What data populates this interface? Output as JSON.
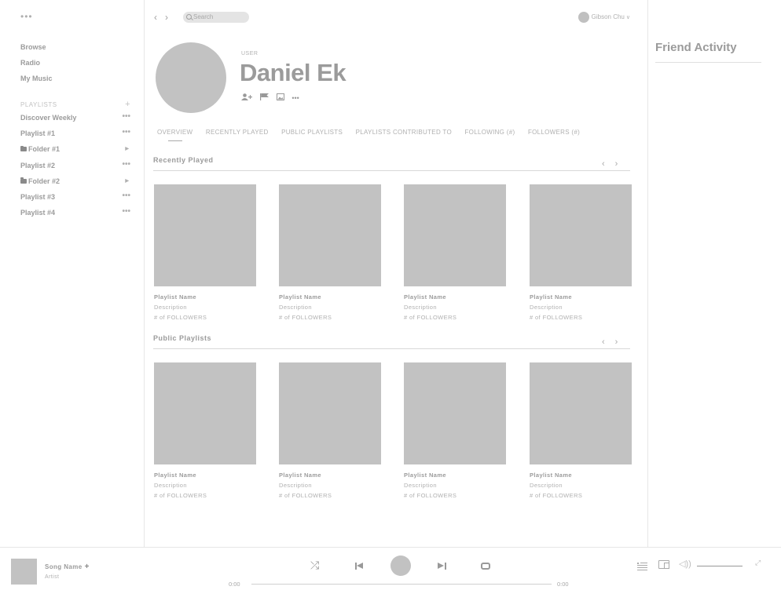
{
  "sidebar": {
    "menu_dots": "•••",
    "nav": [
      "Browse",
      "Radio",
      "My Music"
    ],
    "playlists_header": "PLAYLISTS",
    "add_symbol": "+",
    "items": [
      {
        "label": "Discover Weekly",
        "type": "playlist"
      },
      {
        "label": "Playlist #1",
        "type": "playlist"
      },
      {
        "label": "Folder #1",
        "type": "folder"
      },
      {
        "label": "Playlist #2",
        "type": "playlist"
      },
      {
        "label": "Folder #2",
        "type": "folder"
      },
      {
        "label": "Playlist #3",
        "type": "playlist"
      },
      {
        "label": "Playlist #4",
        "type": "playlist"
      }
    ],
    "more_symbol": "•••"
  },
  "topbar": {
    "search_placeholder": "Search",
    "user_name": "Gibson Chu"
  },
  "profile": {
    "type_label": "USER",
    "name": "Daniel Ek"
  },
  "tabs": [
    "OVERVIEW",
    "RECENTLY PLAYED",
    "PUBLIC PLAYLISTS",
    "PLAYLISTS CONTRIBUTED TO",
    "FOLLOWING (#)",
    "FOLLOWERS (#)"
  ],
  "sections": {
    "recently_played": {
      "title": "Recently Played",
      "cards": [
        {
          "name": "Playlist Name",
          "desc": "Description",
          "followers": "# of FOLLOWERS"
        },
        {
          "name": "Playlist Name",
          "desc": "Description",
          "followers": "# of FOLLOWERS"
        },
        {
          "name": "Playlist Name",
          "desc": "Description",
          "followers": "# of FOLLOWERS"
        },
        {
          "name": "Playlist Name",
          "desc": "Description",
          "followers": "# of FOLLOWERS"
        }
      ]
    },
    "public_playlists": {
      "title": "Public Playlists",
      "cards": [
        {
          "name": "Playlist Name",
          "desc": "Description",
          "followers": "# of FOLLOWERS"
        },
        {
          "name": "Playlist Name",
          "desc": "Description",
          "followers": "# of FOLLOWERS"
        },
        {
          "name": "Playlist Name",
          "desc": "Description",
          "followers": "# of FOLLOWERS"
        },
        {
          "name": "Playlist Name",
          "desc": "Description",
          "followers": "# of FOLLOWERS"
        }
      ]
    }
  },
  "friends": {
    "title": "Friend Activity"
  },
  "player": {
    "song_name": "Song Name",
    "artist": "Artist",
    "time_elapsed": "0:00",
    "time_total": "0:00"
  }
}
